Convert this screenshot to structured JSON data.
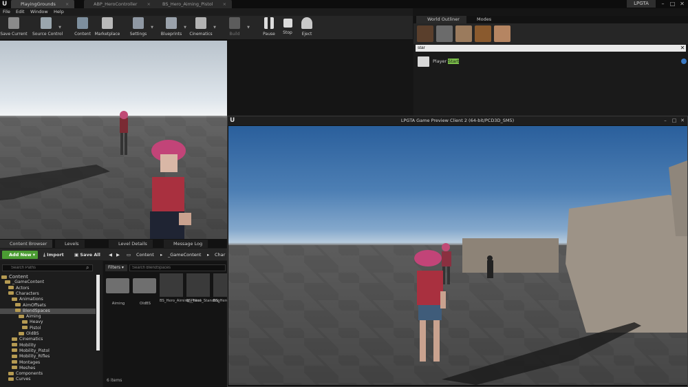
{
  "titlebar": {
    "tabs": [
      {
        "label": "PlayingGrounds",
        "active": true
      },
      {
        "label": "ABP_HeroController",
        "active": false
      },
      {
        "label": "BS_Hero_Aiming_Pistol",
        "active": false
      }
    ],
    "project": "LPGTA",
    "controls": {
      "minimize": "–",
      "maximize": "□",
      "close": "✕"
    }
  },
  "menu": [
    "File",
    "Edit",
    "Window",
    "Help"
  ],
  "toolbar": [
    {
      "label": "Save Current",
      "icon": "save-icon"
    },
    {
      "label": "Source Control",
      "icon": "source-control-icon"
    },
    {
      "label": "Content",
      "icon": "content-icon"
    },
    {
      "label": "Marketplace",
      "icon": "marketplace-icon"
    },
    {
      "label": "Settings",
      "icon": "settings-icon"
    },
    {
      "label": "Blueprints",
      "icon": "blueprints-icon"
    },
    {
      "label": "Cinematics",
      "icon": "cinematics-icon"
    },
    {
      "label": "Build",
      "icon": "build-icon"
    },
    {
      "label": "Pause",
      "icon": "pause-icon"
    },
    {
      "label": "Stop",
      "icon": "stop-icon"
    },
    {
      "label": "Eject",
      "icon": "eject-icon"
    }
  ],
  "outliner": {
    "tabs": [
      "World Outliner",
      "Modes"
    ],
    "search_value": "star",
    "result": {
      "prefix": "Player ",
      "highlight": "Start"
    }
  },
  "preview": {
    "title": "LPGTA Game Preview Client 2 (64-bit/PCD3D_SM5)"
  },
  "content_browser": {
    "tabs": [
      "Content Browser",
      "Levels",
      "Level Details",
      "Message Log"
    ],
    "add_new": "Add New",
    "import": "Import",
    "save_all": "Save All",
    "breadcrumb": [
      "Content",
      "_GameContent",
      "Char"
    ],
    "tree_search_placeholder": "Search Paths",
    "tree": [
      {
        "label": "Content",
        "indent": 0,
        "root": true
      },
      {
        "label": "_GameContent",
        "indent": 1
      },
      {
        "label": "Actors",
        "indent": 2
      },
      {
        "label": "Characters",
        "indent": 2
      },
      {
        "label": "Animations",
        "indent": 3
      },
      {
        "label": "AimOffsets",
        "indent": 4
      },
      {
        "label": "BlendSpaces",
        "indent": 4,
        "selected": true
      },
      {
        "label": "Aiming",
        "indent": 5
      },
      {
        "label": "Heavy",
        "indent": 6
      },
      {
        "label": "Pistol",
        "indent": 6
      },
      {
        "label": "OldBS",
        "indent": 5
      },
      {
        "label": "Cinematics",
        "indent": 3
      },
      {
        "label": "Mobility",
        "indent": 3
      },
      {
        "label": "Mobility_Pistol",
        "indent": 3
      },
      {
        "label": "Mobility_Rifles",
        "indent": 3
      },
      {
        "label": "Montages",
        "indent": 3
      },
      {
        "label": "Meshes",
        "indent": 3
      },
      {
        "label": "Components",
        "indent": 2
      },
      {
        "label": "Curves",
        "indent": 2
      }
    ],
    "filters_label": "Filters",
    "asset_search_placeholder": "Search BlendSpaces",
    "assets": [
      {
        "label": "Aiming",
        "kind": "folder"
      },
      {
        "label": "OldBS",
        "kind": "folder"
      },
      {
        "label": "BS_Hero_Aiming_Pistol",
        "kind": "asset"
      },
      {
        "label": "BS_Hero_Standing",
        "kind": "asset"
      },
      {
        "label": "BS_Hero_...",
        "kind": "asset"
      }
    ],
    "item_count": "6 items"
  }
}
